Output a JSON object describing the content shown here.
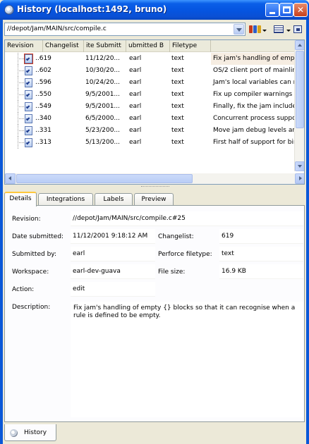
{
  "window": {
    "title": "History (localhost:1492, bruno)"
  },
  "path": {
    "value": "//depot/Jam/MAIN/src/compile.c"
  },
  "columns": [
    "Revision",
    "Changelist",
    "ite Submitt",
    "ubmitted B",
    "Filetype"
  ],
  "rows": [
    {
      "rev": "..619",
      "date": "11/12/20...",
      "user": "earl",
      "type": "text",
      "desc": "Fix jam's handling of empty"
    },
    {
      "rev": "..602",
      "date": "10/30/20...",
      "user": "earl",
      "type": "text",
      "desc": "OS/2 client port of mainline"
    },
    {
      "rev": "..596",
      "date": "10/24/20...",
      "user": "earl",
      "type": "text",
      "desc": "Jam's local variables can no"
    },
    {
      "rev": "..550",
      "date": "9/5/2001...",
      "user": "earl",
      "type": "text",
      "desc": "Fix up compiler warnings fro"
    },
    {
      "rev": "..549",
      "date": "9/5/2001...",
      "user": "earl",
      "type": "text",
      "desc": "Finally, fix the jam include b"
    },
    {
      "rev": "..340",
      "date": "6/5/2000...",
      "user": "earl",
      "type": "text",
      "desc": "Concurrent process suppor"
    },
    {
      "rev": "..331",
      "date": "5/23/200...",
      "user": "earl",
      "type": "text",
      "desc": "Move jam debug levels arou"
    },
    {
      "rev": "..313",
      "date": "5/13/200...",
      "user": "earl",
      "type": "text",
      "desc": "First half of support for bin"
    }
  ],
  "tabs": [
    "Details",
    "Integrations",
    "Labels",
    "Preview"
  ],
  "details": {
    "revision_label": "Revision:",
    "revision": "//depot/Jam/MAIN/src/compile.c#25",
    "date_label": "Date submitted:",
    "date": "11/12/2001 9:18:12 AM",
    "changelist_label": "Changelist:",
    "changelist": "619",
    "submitted_label": "Submitted by:",
    "submitted": "earl",
    "filetype_label": "Perforce filetype:",
    "filetype": "text",
    "workspace_label": "Workspace:",
    "workspace": "earl-dev-guava",
    "filesize_label": "File size:",
    "filesize": "16.9 KB",
    "action_label": "Action:",
    "action": "edit",
    "description_label": "Description:",
    "description": "Fix jam's handling of empty {} blocks so that it can recognise when a rule is defined to be empty."
  },
  "bottom_tab": {
    "label": "History"
  }
}
